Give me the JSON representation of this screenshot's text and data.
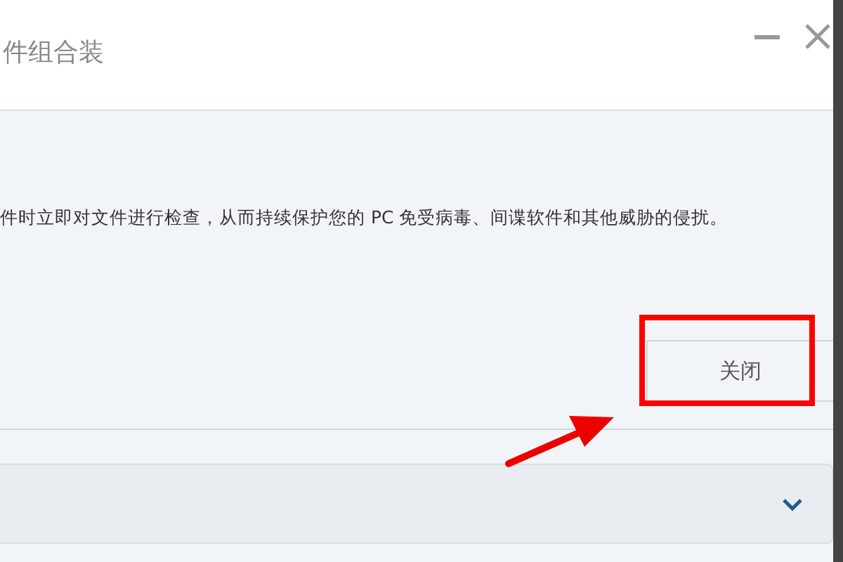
{
  "window": {
    "title": "件组合装"
  },
  "description": "件时立即对文件进行检查，从而持续保护您的 PC 免受病毒、间谍软件和其他威胁的侵扰。",
  "close_button": {
    "label": "关闭"
  },
  "collapsed_panel": {
    "expanded": false
  }
}
